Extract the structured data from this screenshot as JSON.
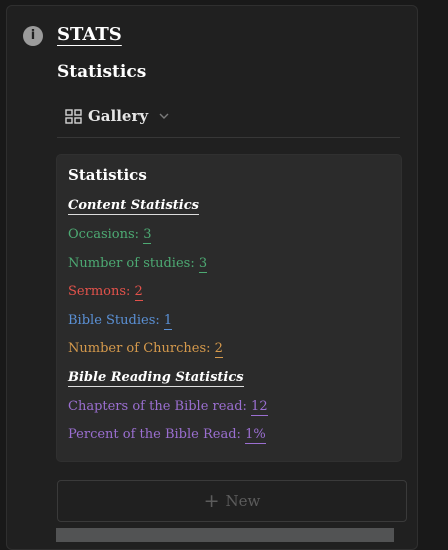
{
  "page": {
    "title": "STATS",
    "subtitle": "Statistics"
  },
  "icons": {
    "info": "info-icon",
    "gallery": "gallery-icon",
    "chevron": "chevron-down-icon",
    "plus": "plus-icon"
  },
  "view": {
    "label": "Gallery"
  },
  "card": {
    "title": "Statistics",
    "content_heading": "Content Statistics",
    "occasions_label": "Occasions:",
    "occasions_value": "3",
    "studies_label": "Number of studies:",
    "studies_value": "3",
    "sermons_label": "Sermons:",
    "sermons_value": "2",
    "bible_studies_label": "Bible Studies:",
    "bible_studies_value": "1",
    "churches_label": "Number of Churches:",
    "churches_value": "2",
    "reading_heading": "Bible Reading Statistics",
    "chapters_label": "Chapters of the Bible read:",
    "chapters_value": "12",
    "percent_label": "Percent of the Bible Read:",
    "percent_value": "1%"
  },
  "new_button": {
    "label": "New"
  },
  "colors": {
    "green": "#4daa73",
    "red": "#e2524b",
    "blue": "#5b91d6",
    "orange": "#d69a4c",
    "purple": "#9b6fd1"
  }
}
